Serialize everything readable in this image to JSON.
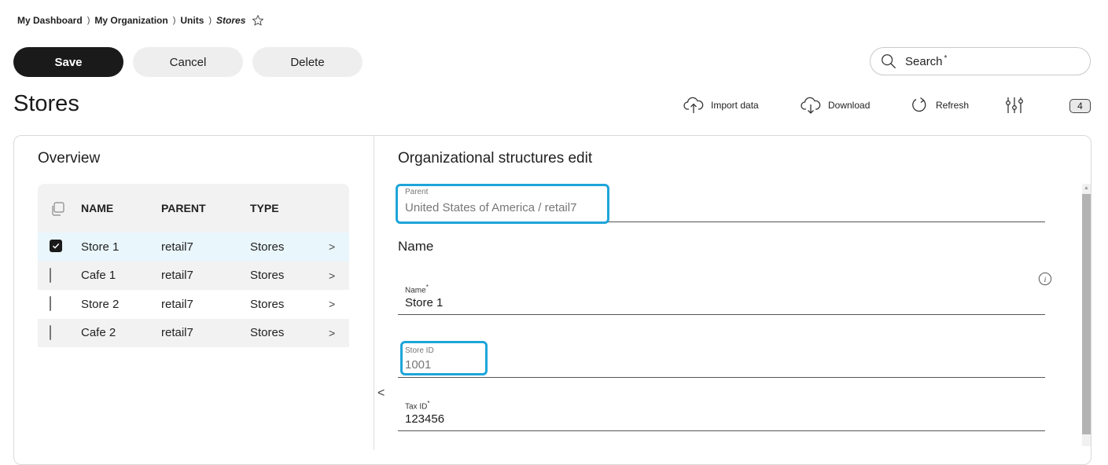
{
  "breadcrumb": {
    "items": [
      "My Dashboard",
      "My Organization",
      "Units"
    ],
    "current": "Stores",
    "separator": ")"
  },
  "toolbar": {
    "save_label": "Save",
    "cancel_label": "Cancel",
    "delete_label": "Delete"
  },
  "search": {
    "label": "Search",
    "required_marker": "*"
  },
  "page": {
    "title": "Stores"
  },
  "actions": {
    "import_label": "Import data",
    "download_label": "Download",
    "refresh_label": "Refresh",
    "filter_count": "4"
  },
  "overview": {
    "title": "Overview",
    "columns": [
      "NAME",
      "PARENT",
      "TYPE"
    ],
    "rows": [
      {
        "name": "Store 1",
        "parent": "retail7",
        "type": "Stores",
        "checked": true
      },
      {
        "name": "Cafe 1",
        "parent": "retail7",
        "type": "Stores",
        "checked": false
      },
      {
        "name": "Store 2",
        "parent": "retail7",
        "type": "Stores",
        "checked": false
      },
      {
        "name": "Cafe 2",
        "parent": "retail7",
        "type": "Stores",
        "checked": false
      }
    ],
    "chevron": ">"
  },
  "form": {
    "title": "Organizational structures edit",
    "parent": {
      "label": "Parent",
      "value": "United States of America / retail7"
    },
    "section_name": "Name",
    "name": {
      "label": "Name",
      "required_marker": "*",
      "value": "Store 1"
    },
    "store_id": {
      "label": "Store ID",
      "value": "1001"
    },
    "tax_id": {
      "label": "Tax ID",
      "required_marker": "*",
      "value": "123456"
    },
    "info_glyph": "i",
    "collapse_glyph": "<"
  },
  "colors": {
    "primary_button": "#1a1a1a",
    "highlight": "#1ea5d9",
    "selected_row": "#e9f6fb"
  }
}
